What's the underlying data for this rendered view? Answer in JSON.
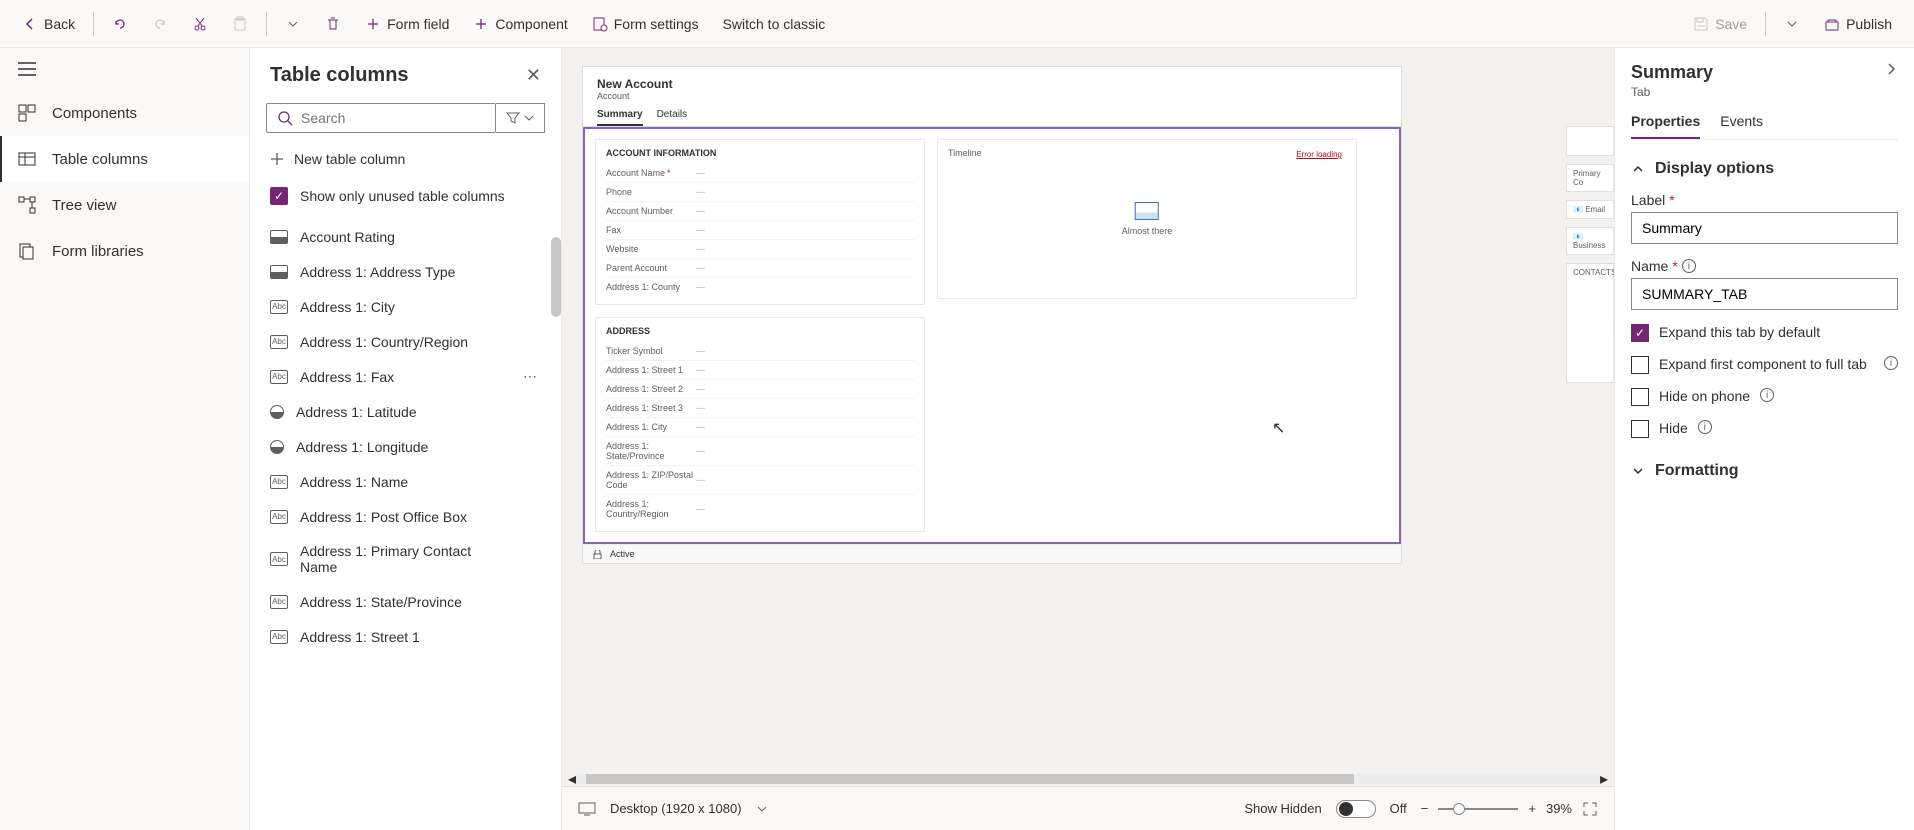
{
  "toolbar": {
    "back": "Back",
    "form_field": "Form field",
    "component": "Component",
    "form_settings": "Form settings",
    "switch_classic": "Switch to classic",
    "save": "Save",
    "publish": "Publish"
  },
  "rail": {
    "items": [
      {
        "label": "Components"
      },
      {
        "label": "Table columns"
      },
      {
        "label": "Tree view"
      },
      {
        "label": "Form libraries"
      }
    ]
  },
  "panel": {
    "title": "Table columns",
    "search_placeholder": "Search",
    "new_column": "New table column",
    "show_only": "Show only unused table columns",
    "columns": [
      {
        "type": "opt",
        "label": "Account Rating"
      },
      {
        "type": "opt",
        "label": "Address 1: Address Type"
      },
      {
        "type": "abc",
        "label": "Address 1: City"
      },
      {
        "type": "abc",
        "label": "Address 1: Country/Region"
      },
      {
        "type": "abc",
        "label": "Address 1: Fax"
      },
      {
        "type": "glob",
        "label": "Address 1: Latitude"
      },
      {
        "type": "glob",
        "label": "Address 1: Longitude"
      },
      {
        "type": "abc",
        "label": "Address 1: Name"
      },
      {
        "type": "abc",
        "label": "Address 1: Post Office Box"
      },
      {
        "type": "abc",
        "label": "Address 1: Primary Contact Name"
      },
      {
        "type": "abc",
        "label": "Address 1: State/Province"
      },
      {
        "type": "abc",
        "label": "Address 1: Street 1"
      }
    ]
  },
  "form": {
    "title": "New Account",
    "subtitle": "Account",
    "tabs": [
      "Summary",
      "Details"
    ],
    "section1_title": "ACCOUNT INFORMATION",
    "section1_fields": [
      {
        "label": "Account Name",
        "req": true,
        "val": "---"
      },
      {
        "label": "Phone",
        "val": "---"
      },
      {
        "label": "Account Number",
        "val": "---"
      },
      {
        "label": "Fax",
        "val": "---"
      },
      {
        "label": "Website",
        "val": "---"
      },
      {
        "label": "Parent Account",
        "val": "---"
      },
      {
        "label": "Address 1: County",
        "val": "---"
      }
    ],
    "section2_title": "ADDRESS",
    "section2_fields": [
      {
        "label": "Ticker Symbol",
        "val": "---"
      },
      {
        "label": "Address 1: Street 1",
        "val": "---"
      },
      {
        "label": "Address 1: Street 2",
        "val": "---"
      },
      {
        "label": "Address 1: Street 3",
        "val": "---"
      },
      {
        "label": "Address 1: City",
        "val": "---"
      },
      {
        "label": "Address 1: State/Province",
        "val": "---"
      },
      {
        "label": "Address 1: ZIP/Postal Code",
        "val": "---"
      },
      {
        "label": "Address 1: Country/Region",
        "val": "---"
      }
    ],
    "timeline_title": "Timeline",
    "timeline_msg": "Almost there",
    "error_link": "Error loading",
    "side": {
      "primary": "Primary Co",
      "email": "Email",
      "business": "Business",
      "contacts": "CONTACTS"
    },
    "status": "Active"
  },
  "footer": {
    "device": "Desktop (1920 x 1080)",
    "show_hidden": "Show Hidden",
    "toggle": "Off",
    "zoom": "39%"
  },
  "props": {
    "title": "Summary",
    "subtitle": "Tab",
    "tabs": [
      "Properties",
      "Events"
    ],
    "section_display": "Display options",
    "label_lbl": "Label",
    "label_val": "Summary",
    "name_lbl": "Name",
    "name_val": "SUMMARY_TAB",
    "expand_default": "Expand this tab by default",
    "expand_first": "Expand first component to full tab",
    "hide_phone": "Hide on phone",
    "hide": "Hide",
    "section_formatting": "Formatting"
  }
}
